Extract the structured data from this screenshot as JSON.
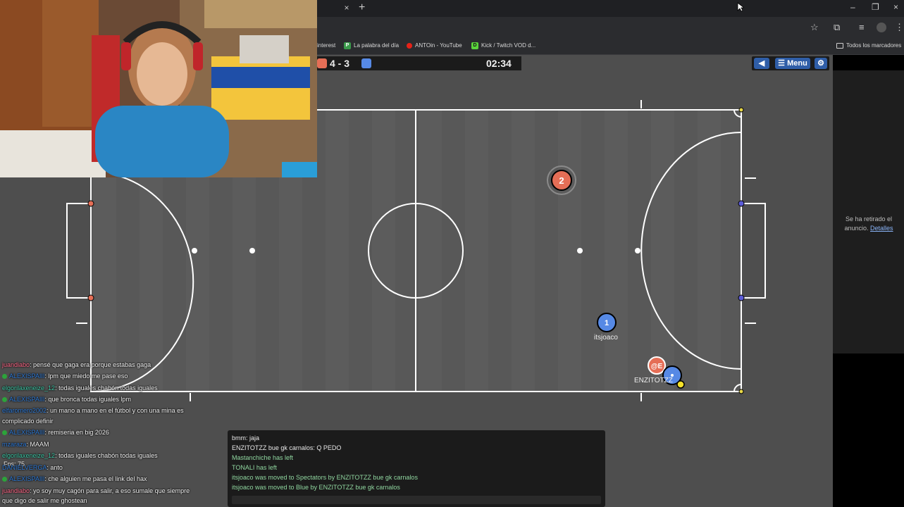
{
  "browser": {
    "tab_close": "×",
    "tab_new": "+",
    "window_controls": [
      "–",
      "❐",
      "×"
    ],
    "bookmarks": [
      {
        "label": "interest",
        "icon": "",
        "color": "#2b2c2f"
      },
      {
        "label": "La palabra del día",
        "icon": "P",
        "color": "#3a9a4a"
      },
      {
        "label": "ANTOin - YouTube",
        "icon": "",
        "color": "#e62117"
      },
      {
        "label": "Kick / Twitch VOD d...",
        "icon": "D",
        "color": "#5ad33b"
      }
    ],
    "all_bookmarks": "Todos los marcadores"
  },
  "game": {
    "score": "4 - 3",
    "red_color": "#e56e56",
    "blue_color": "#5689e5",
    "timer": "02:34",
    "menu_label": "Menu",
    "players": [
      {
        "number": "2",
        "team": "red",
        "name": ""
      },
      {
        "number": "1",
        "team": "blue",
        "name": "itsjoaco"
      },
      {
        "number": "@E",
        "team": "red",
        "name": "ENZITOTZZ"
      }
    ]
  },
  "ad": {
    "text": "Se ha retirado el anuncio.",
    "link": "Detalles"
  },
  "stream_chat": [
    {
      "user": "juandiabo",
      "color": "#ff6b8a",
      "badge": false,
      "text": ": pensé que gaga era porque estabas gaga"
    },
    {
      "user": "ALEXISPAIII",
      "color": "#2f7bd8",
      "badge": true,
      "text": ": lpm que miedo me pase eso"
    },
    {
      "user": "elgorilaxeneize_12",
      "color": "#3ec7a6",
      "badge": false,
      "text": ": todas iguales chabón todas iguales"
    },
    {
      "user": "ALEXISPAIII",
      "color": "#2f7bd8",
      "badge": true,
      "text": ": que bronca todas iguales lpm"
    },
    {
      "user": "elfaromero2002",
      "color": "#2f7bd8",
      "badge": false,
      "text": ": un mano a mano en el fútbol y con una mina es"
    },
    {
      "user": "",
      "color": "#f2f2f2",
      "badge": false,
      "text": "complicado definir"
    },
    {
      "user": "ALEXISPAIII",
      "color": "#2f7bd8",
      "badge": true,
      "text": ": remiseria en big 2026"
    },
    {
      "user": "mzaraza",
      "color": "#2f7bd8",
      "badge": false,
      "text": ": MAAM"
    },
    {
      "user": "elgorilaxeneize_12",
      "color": "#3ec7a6",
      "badge": false,
      "text": ": todas iguales chabón todas iguales"
    },
    {
      "user": "DANIELVERGA",
      "color": "#2f7bd8",
      "badge": false,
      "text": ": anto"
    },
    {
      "user": "ALEXISPAIII",
      "color": "#2f7bd8",
      "badge": true,
      "text": ": che alguien me pasa el link del hax"
    },
    {
      "user": "juandiabo",
      "color": "#ff6b8a",
      "badge": false,
      "text": ": yo soy muy cagón para salir, a eso sumale que siempre"
    },
    {
      "user": "",
      "color": "#f2f2f2",
      "badge": false,
      "text": "que digo de salir me ghostean"
    }
  ],
  "fps": "Fps: 75",
  "game_chat": [
    {
      "text": "bmm: jaja",
      "color": "#e8e8e8"
    },
    {
      "text": "ENZITOTZZ bue gk carnalos: Q PEDO",
      "color": "#e8e8e8"
    },
    {
      "text": "Mastanchiche has left",
      "color": "#90d7a0"
    },
    {
      "text": "TONALI has left",
      "color": "#90d7a0"
    },
    {
      "text": "itsjoaco was moved to Spectators by ENZITOTZZ bue gk carnalos",
      "color": "#90d7a0"
    },
    {
      "text": "itsjoaco was moved to Blue by ENZITOTZZ bue gk carnalos",
      "color": "#90d7a0"
    }
  ]
}
